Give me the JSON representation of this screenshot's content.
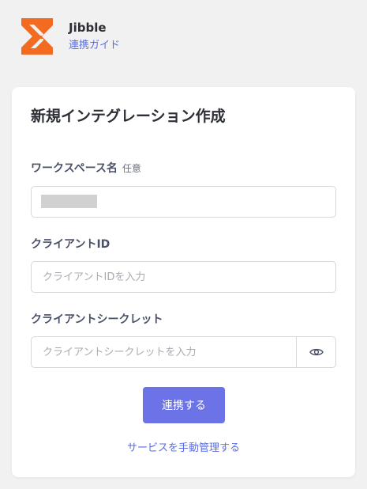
{
  "header": {
    "brand_name": "Jibble",
    "guide_link": "連携ガイド",
    "logo_icon": "jibble-hourglass-logo",
    "logo_color": "#f26b21"
  },
  "form": {
    "title": "新規インテグレーション作成",
    "workspace": {
      "label": "ワークスペース名",
      "optional": "任意",
      "value": ""
    },
    "client_id": {
      "label": "クライアントID",
      "placeholder": "クライアントIDを入力"
    },
    "client_secret": {
      "label": "クライアントシークレット",
      "placeholder": "クライアントシークレットを入力",
      "toggle_icon": "eye-icon"
    },
    "submit_label": "連携する",
    "manual_link": "サービスを手動管理する"
  },
  "colors": {
    "accent": "#6c73e6",
    "link": "#5b6ee1",
    "background": "#f1f1f1"
  }
}
